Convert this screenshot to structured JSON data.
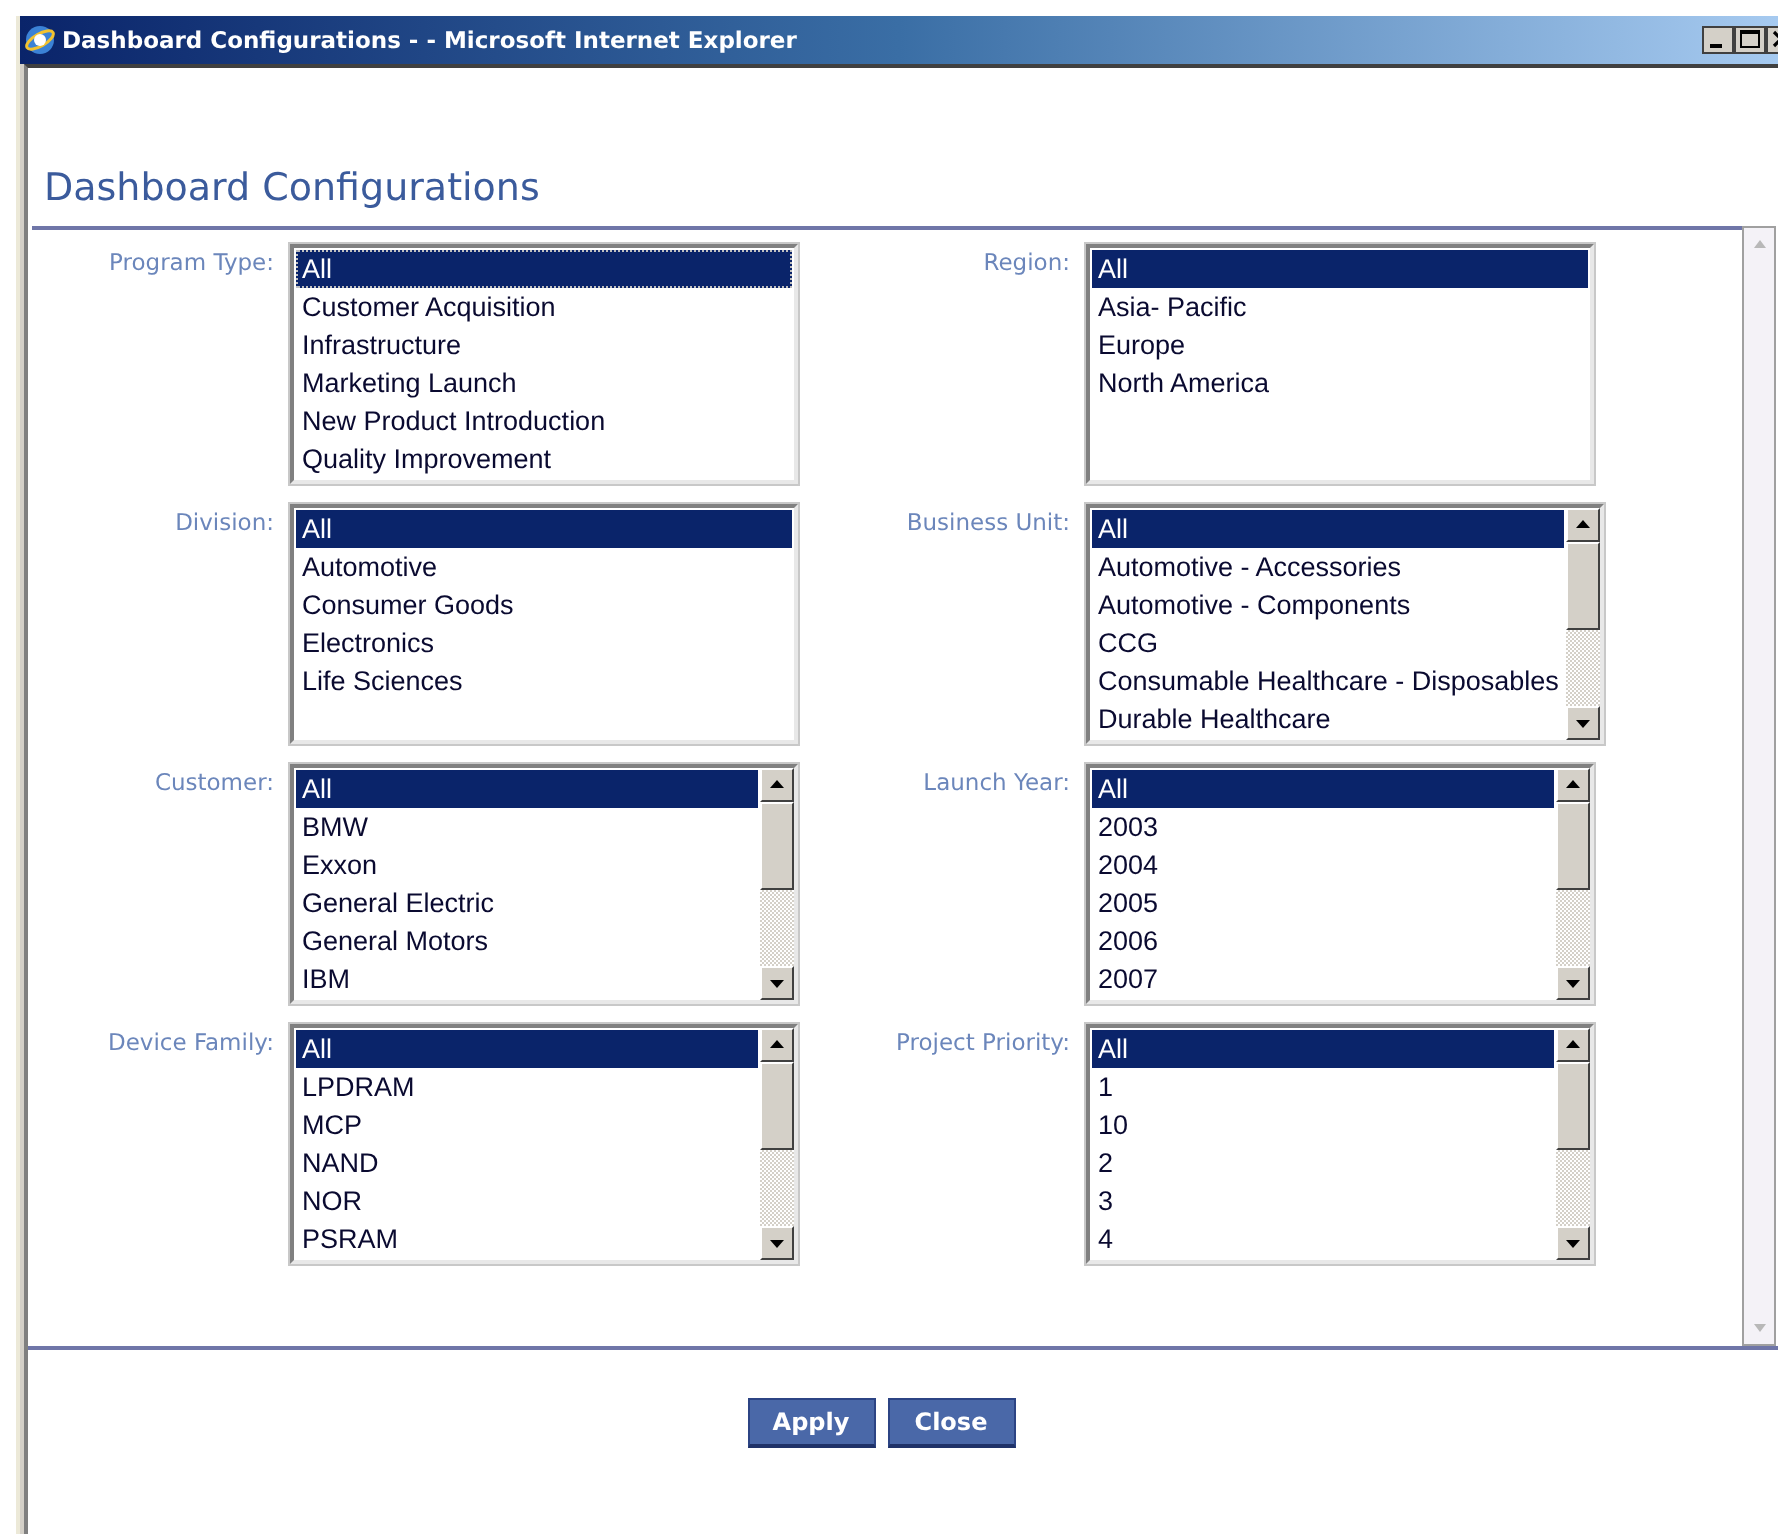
{
  "window": {
    "title": "Dashboard Configurations - - Microsoft Internet Explorer"
  },
  "heading": "Dashboard Configurations",
  "filters": [
    {
      "label": "Program Type:",
      "scrollbar": false,
      "focused": true,
      "options": [
        {
          "text": "All",
          "selected": true
        },
        {
          "text": "Customer Acquisition",
          "selected": false
        },
        {
          "text": "Infrastructure",
          "selected": false
        },
        {
          "text": "Marketing Launch",
          "selected": false
        },
        {
          "text": "New Product Introduction",
          "selected": false
        },
        {
          "text": "Quality Improvement",
          "selected": false
        }
      ]
    },
    {
      "label": "Region:",
      "scrollbar": false,
      "focused": false,
      "options": [
        {
          "text": "All",
          "selected": true
        },
        {
          "text": "Asia- Pacific",
          "selected": false
        },
        {
          "text": "Europe",
          "selected": false
        },
        {
          "text": "North America",
          "selected": false
        }
      ]
    },
    {
      "label": "Division:",
      "scrollbar": false,
      "focused": false,
      "options": [
        {
          "text": "All",
          "selected": true
        },
        {
          "text": "Automotive",
          "selected": false
        },
        {
          "text": "Consumer Goods",
          "selected": false
        },
        {
          "text": "Electronics",
          "selected": false
        },
        {
          "text": "Life Sciences",
          "selected": false
        }
      ]
    },
    {
      "label": "Business Unit:",
      "scrollbar": true,
      "focused": false,
      "options": [
        {
          "text": "All",
          "selected": true
        },
        {
          "text": "Automotive - Accessories",
          "selected": false
        },
        {
          "text": "Automotive - Components",
          "selected": false
        },
        {
          "text": "CCG",
          "selected": false
        },
        {
          "text": "Consumable Healthcare - Disposables",
          "selected": false
        },
        {
          "text": "Durable Healthcare",
          "selected": false
        }
      ]
    },
    {
      "label": "Customer:",
      "scrollbar": true,
      "focused": false,
      "options": [
        {
          "text": "All",
          "selected": true
        },
        {
          "text": "BMW",
          "selected": false
        },
        {
          "text": "Exxon",
          "selected": false
        },
        {
          "text": "General Electric",
          "selected": false
        },
        {
          "text": "General Motors",
          "selected": false
        },
        {
          "text": "IBM",
          "selected": false
        }
      ]
    },
    {
      "label": "Launch Year:",
      "scrollbar": true,
      "focused": false,
      "options": [
        {
          "text": "All",
          "selected": true
        },
        {
          "text": "2003",
          "selected": false
        },
        {
          "text": "2004",
          "selected": false
        },
        {
          "text": "2005",
          "selected": false
        },
        {
          "text": "2006",
          "selected": false
        },
        {
          "text": "2007",
          "selected": false
        }
      ]
    },
    {
      "label": "Device Family:",
      "scrollbar": true,
      "focused": false,
      "options": [
        {
          "text": "All",
          "selected": true
        },
        {
          "text": "LPDRAM",
          "selected": false
        },
        {
          "text": "MCP",
          "selected": false
        },
        {
          "text": "NAND",
          "selected": false
        },
        {
          "text": "NOR",
          "selected": false
        },
        {
          "text": "PSRAM",
          "selected": false
        }
      ]
    },
    {
      "label": "Project Priority:",
      "scrollbar": true,
      "focused": false,
      "options": [
        {
          "text": "All",
          "selected": true
        },
        {
          "text": "1",
          "selected": false
        },
        {
          "text": "10",
          "selected": false
        },
        {
          "text": "2",
          "selected": false
        },
        {
          "text": "3",
          "selected": false
        },
        {
          "text": "4",
          "selected": false
        }
      ]
    }
  ],
  "buttons": [
    {
      "label": "Apply"
    },
    {
      "label": "Close"
    }
  ]
}
